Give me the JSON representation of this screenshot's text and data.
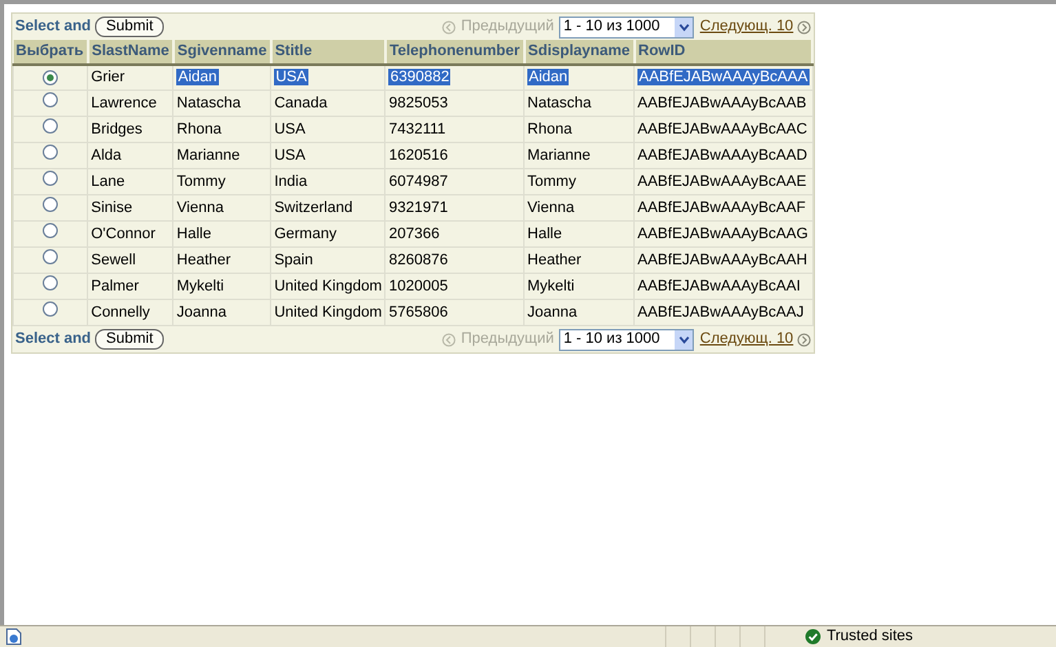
{
  "top_bar": {
    "label": "Select and",
    "submit": "Submit",
    "previous": {
      "label": "Предыдущий",
      "disabled": true
    },
    "range": "1 - 10 из 1000",
    "next": {
      "label": "Следующ. 10",
      "disabled": false
    }
  },
  "table": {
    "select_column": "Выбрать",
    "columns": [
      "SlastName",
      "Sgivenname",
      "Stitle",
      "Telephonenumber",
      "Sdisplayname",
      "RowID"
    ],
    "rows": [
      {
        "selected": true,
        "cells": [
          {
            "text": "Grier",
            "highlighted": false
          },
          {
            "text": "Aidan",
            "highlighted": true
          },
          {
            "text": "USA",
            "highlighted": true
          },
          {
            "text": "6390882",
            "highlighted": true
          },
          {
            "text": "Aidan",
            "highlighted": true
          },
          {
            "text": "AABfEJABwAAAyBcAAA",
            "highlighted": true
          }
        ]
      },
      {
        "selected": false,
        "cells": [
          {
            "text": "Lawrence",
            "highlighted": false
          },
          {
            "text": "Natascha",
            "highlighted": false
          },
          {
            "text": "Canada",
            "highlighted": false
          },
          {
            "text": "9825053",
            "highlighted": false
          },
          {
            "text": "Natascha",
            "highlighted": false
          },
          {
            "text": "AABfEJABwAAAyBcAAB",
            "highlighted": false
          }
        ]
      },
      {
        "selected": false,
        "cells": [
          {
            "text": "Bridges",
            "highlighted": false
          },
          {
            "text": "Rhona",
            "highlighted": false
          },
          {
            "text": "USA",
            "highlighted": false
          },
          {
            "text": "7432111",
            "highlighted": false
          },
          {
            "text": "Rhona",
            "highlighted": false
          },
          {
            "text": "AABfEJABwAAAyBcAAC",
            "highlighted": false
          }
        ]
      },
      {
        "selected": false,
        "cells": [
          {
            "text": "Alda",
            "highlighted": false
          },
          {
            "text": "Marianne",
            "highlighted": false
          },
          {
            "text": "USA",
            "highlighted": false
          },
          {
            "text": "1620516",
            "highlighted": false
          },
          {
            "text": "Marianne",
            "highlighted": false
          },
          {
            "text": "AABfEJABwAAAyBcAAD",
            "highlighted": false
          }
        ]
      },
      {
        "selected": false,
        "cells": [
          {
            "text": "Lane",
            "highlighted": false
          },
          {
            "text": "Tommy",
            "highlighted": false
          },
          {
            "text": "India",
            "highlighted": false
          },
          {
            "text": "6074987",
            "highlighted": false
          },
          {
            "text": "Tommy",
            "highlighted": false
          },
          {
            "text": "AABfEJABwAAAyBcAAE",
            "highlighted": false
          }
        ]
      },
      {
        "selected": false,
        "cells": [
          {
            "text": "Sinise",
            "highlighted": false
          },
          {
            "text": "Vienna",
            "highlighted": false
          },
          {
            "text": "Switzerland",
            "highlighted": false
          },
          {
            "text": "9321971",
            "highlighted": false
          },
          {
            "text": "Vienna",
            "highlighted": false
          },
          {
            "text": "AABfEJABwAAAyBcAAF",
            "highlighted": false
          }
        ]
      },
      {
        "selected": false,
        "cells": [
          {
            "text": "O'Connor",
            "highlighted": false
          },
          {
            "text": "Halle",
            "highlighted": false
          },
          {
            "text": "Germany",
            "highlighted": false
          },
          {
            "text": "207366",
            "highlighted": false
          },
          {
            "text": "Halle",
            "highlighted": false
          },
          {
            "text": "AABfEJABwAAAyBcAAG",
            "highlighted": false
          }
        ]
      },
      {
        "selected": false,
        "cells": [
          {
            "text": "Sewell",
            "highlighted": false
          },
          {
            "text": "Heather",
            "highlighted": false
          },
          {
            "text": "Spain",
            "highlighted": false
          },
          {
            "text": "8260876",
            "highlighted": false
          },
          {
            "text": "Heather",
            "highlighted": false
          },
          {
            "text": "AABfEJABwAAAyBcAAH",
            "highlighted": false
          }
        ]
      },
      {
        "selected": false,
        "cells": [
          {
            "text": "Palmer",
            "highlighted": false
          },
          {
            "text": "Mykelti",
            "highlighted": false
          },
          {
            "text": "United Kingdom",
            "highlighted": false
          },
          {
            "text": "1020005",
            "highlighted": false
          },
          {
            "text": "Mykelti",
            "highlighted": false
          },
          {
            "text": "AABfEJABwAAAyBcAAI",
            "highlighted": false
          }
        ]
      },
      {
        "selected": false,
        "cells": [
          {
            "text": "Connelly",
            "highlighted": false
          },
          {
            "text": "Joanna",
            "highlighted": false
          },
          {
            "text": "United Kingdom",
            "highlighted": false
          },
          {
            "text": "5765806",
            "highlighted": false
          },
          {
            "text": "Joanna",
            "highlighted": false
          },
          {
            "text": "AABfEJABwAAAyBcAAJ",
            "highlighted": false
          }
        ]
      }
    ]
  },
  "bottom_bar": {
    "label": "Select and",
    "submit": "Submit",
    "previous": {
      "label": "Предыдущий",
      "disabled": true
    },
    "range": "1 - 10 из 1000",
    "next": {
      "label": "Следующ. 10",
      "disabled": false
    }
  },
  "status_bar": {
    "zone": "Trusted sites"
  }
}
